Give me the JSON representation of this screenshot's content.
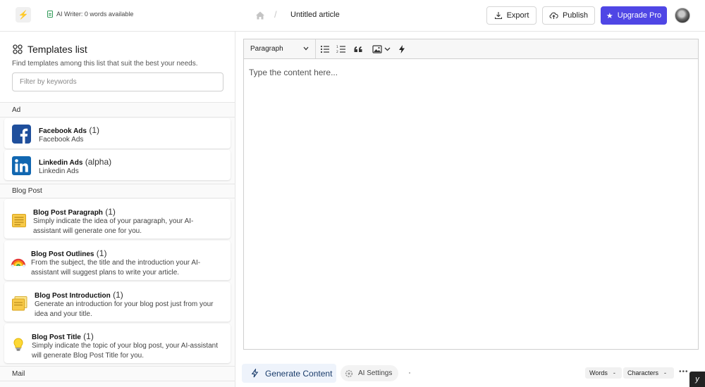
{
  "header": {
    "ai_writer_status": "AI Writer: 0 words available",
    "breadcrumb_title": "Untitled article",
    "export_label": "Export",
    "publish_label": "Publish",
    "upgrade_label": "Upgrade Pro",
    "upgrade_color": "#4f46e5"
  },
  "sidebar": {
    "title": "Templates list",
    "subtitle": "Find templates among this list that suit the best your needs.",
    "filter_placeholder": "Filter by keywords",
    "sections": [
      {
        "label": "Ad",
        "items": [
          {
            "title": "Facebook Ads",
            "count": "(1)",
            "desc": "Facebook Ads",
            "icon": "facebook-icon"
          },
          {
            "title": "Linkedin Ads",
            "count": "(alpha)",
            "desc": "Linkedin Ads",
            "icon": "linkedin-icon"
          }
        ]
      },
      {
        "label": "Blog Post",
        "items": [
          {
            "title": "Blog Post Paragraph",
            "count": "(1)",
            "desc": "Simply indicate the idea of your paragraph, your AI-assistant will generate one for you.",
            "icon": "notepad-icon"
          },
          {
            "title": "Blog Post Outlines",
            "count": "(1)",
            "desc": "From the subject, the title and the introduction your AI-assistant will suggest plans to write your article.",
            "icon": "rainbow-icon"
          },
          {
            "title": "Blog Post Introduction",
            "count": "(1)",
            "desc": "Generate an introduction for your blog post just from your idea and your title.",
            "icon": "sticky-notes-icon"
          },
          {
            "title": "Blog Post Title",
            "count": "(1)",
            "desc": "Simply indicate the topic of your blog post, your AI-assistant will generate Blog Post Title for you.",
            "icon": "lightbulb-icon"
          }
        ]
      },
      {
        "label": "Mail",
        "items": []
      }
    ]
  },
  "editor": {
    "block_type": "Paragraph",
    "placeholder": "Type the content here..."
  },
  "footer": {
    "generate_label": "Generate Content",
    "ai_settings_label": "AI Settings",
    "words_label": "Words",
    "words_value": "-",
    "characters_label": "Characters",
    "characters_value": "-",
    "more_label": "•••"
  }
}
